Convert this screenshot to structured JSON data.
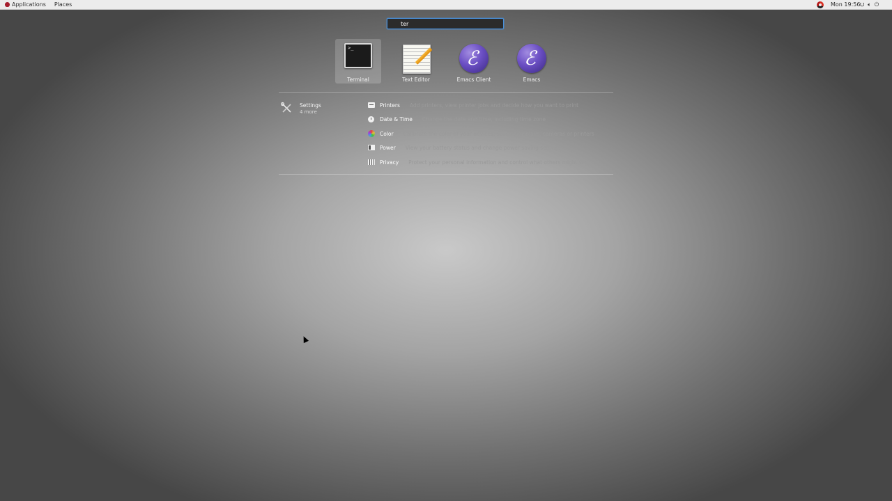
{
  "topbar": {
    "applications_label": "Applications",
    "places_label": "Places",
    "clock": "Mon 19:56",
    "tray_icons": [
      "network-icon",
      "volume-icon",
      "power-icon"
    ]
  },
  "search": {
    "value": "ter"
  },
  "apps": [
    {
      "label": "Terminal",
      "icon": "terminal-icon",
      "selected": true
    },
    {
      "label": "Text Editor",
      "icon": "text-editor-icon",
      "selected": false
    },
    {
      "label": "Emacs Client",
      "icon": "emacs-icon",
      "selected": false
    },
    {
      "label": "Emacs",
      "icon": "emacs-icon",
      "selected": false
    }
  ],
  "settings_provider": {
    "name": "Settings",
    "more": "4 more",
    "icon": "settings-tools-icon"
  },
  "settings_results": [
    {
      "title": "Printers",
      "description": "Add printers, view printer jobs and decide how you want to print",
      "icon": "printer-icon"
    },
    {
      "title": "Date & Time",
      "description": "Change the date and time, including time zone",
      "icon": "clock-icon"
    },
    {
      "title": "Color",
      "description": "Calibrate the color of your devices, such as displays, cameras or printers",
      "icon": "color-icon"
    },
    {
      "title": "Power",
      "description": "View your battery status and change power saving settings",
      "icon": "power-icon"
    },
    {
      "title": "Privacy",
      "description": "Protect your personal information and control what others might see",
      "icon": "privacy-icon"
    }
  ],
  "colors": {
    "topbar_bg": "#ececec",
    "search_border": "#4a90d9",
    "selected_tile": "rgba(255,255,255,0.18)",
    "emacs_purple": "#6b4fc4"
  }
}
